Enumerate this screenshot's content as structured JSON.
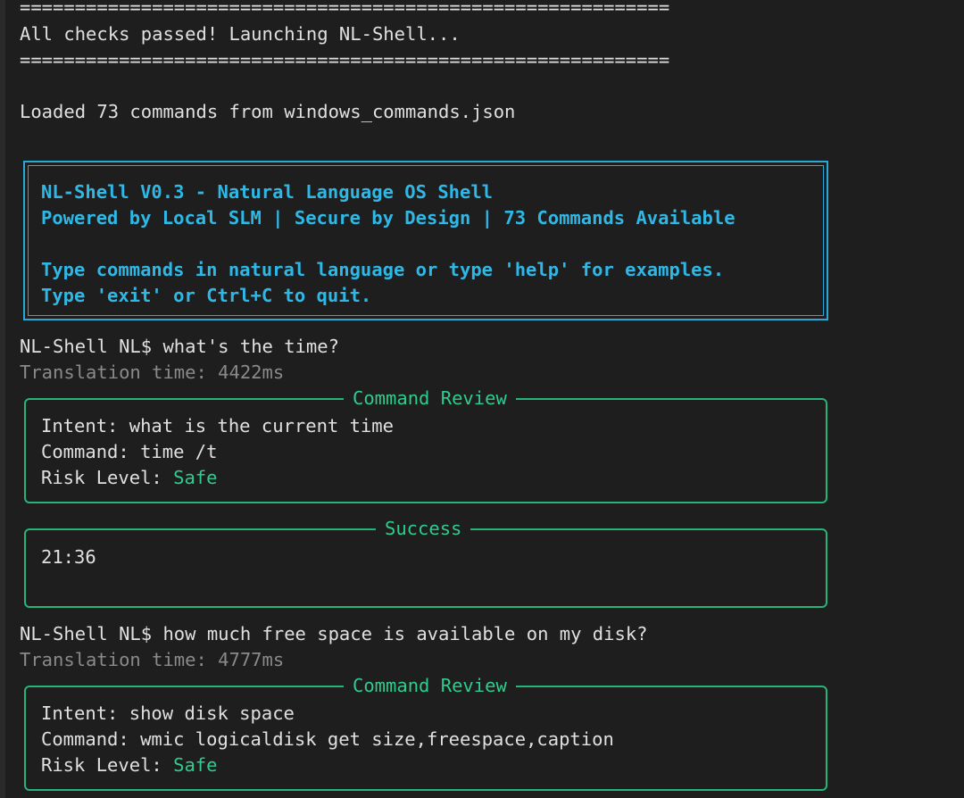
{
  "separator": "===========================================================",
  "header": {
    "status": "All checks passed! Launching NL-Shell...",
    "loaded": "Loaded 73 commands from windows_commands.json"
  },
  "banner": {
    "line1": "NL-Shell V0.3 - Natural Language OS Shell",
    "line2": "Powered by Local SLM | Secure by Design | 73 Commands Available",
    "line3": "Type commands in natural language or type 'help' for examples.",
    "line4": "Type 'exit' or Ctrl+C to quit."
  },
  "prompt": "NL-Shell NL$",
  "entries": [
    {
      "query": "what's the time?",
      "translation": "Translation time: 4422ms",
      "review_title": "Command Review",
      "intent_label": "Intent:",
      "intent": "what is the current time",
      "command_label": "Command:",
      "command": "time /t",
      "risk_label": "Risk Level:",
      "risk": "Safe",
      "result_title": "Success",
      "result": "21:36"
    },
    {
      "query": "how much free space is available on my disk?",
      "translation": "Translation time: 4777ms",
      "review_title": "Command Review",
      "intent_label": "Intent:",
      "intent": "show disk space",
      "command_label": "Command:",
      "command": "wmic logicaldisk get size,freespace,caption",
      "risk_label": "Risk Level:",
      "risk": "Safe"
    }
  ],
  "colors": {
    "background": "#1e1e1e",
    "banner": "#2aa9d9",
    "box_border": "#27b37c",
    "safe": "#2ecc8f",
    "dim": "#8a8a8a"
  }
}
